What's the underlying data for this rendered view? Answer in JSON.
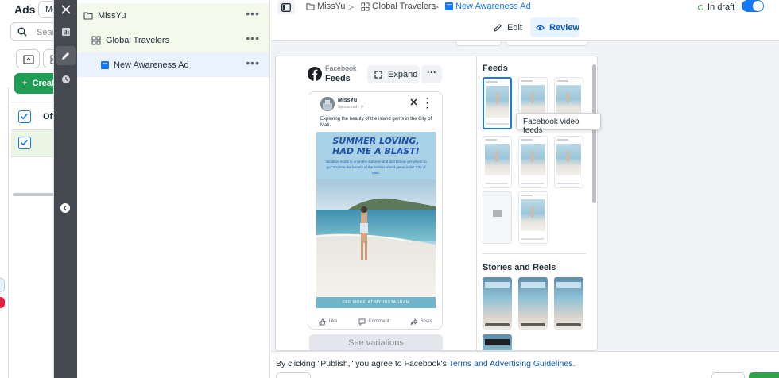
{
  "left_panel": {
    "title": "Ads",
    "tab_label": "Me",
    "search_placeholder": "Searc",
    "create_label": "Creat",
    "row_label": "Off"
  },
  "tree": {
    "items": [
      {
        "label": "MissYu",
        "icon": "folder-icon"
      },
      {
        "label": "Global Travelers",
        "icon": "grid-icon"
      },
      {
        "label": "New Awareness Ad",
        "icon": "ad-square-icon"
      }
    ],
    "more_glyph": "•••"
  },
  "topbar": {
    "breadcrumb": [
      "MissYu",
      "Global Travelers",
      "New Awareness Ad"
    ],
    "status": "In draft",
    "edit_label": "Edit",
    "review_label": "Review"
  },
  "preview": {
    "platform": "Facebook",
    "placement": "Feeds",
    "expand_label": "Expand",
    "more_glyph": "···",
    "post": {
      "page_name": "MissYu",
      "sponsored": "Sponsored · ⚲",
      "primary_text": "Exploring the beauty of the island gems in the City of Mati.",
      "headline": "SUMMER LOVING, HAD ME A BLAST!",
      "subtext": "Vacation mode is on in the summer and don't know yet where to go? Explore the beauty of the hidden island gems in the City of Mati.",
      "cta_text": "SEE MORE AT MY INSTAGRAM",
      "actions": [
        "Like",
        "Comment",
        "Share"
      ]
    },
    "see_variations_label": "See variations"
  },
  "placements": {
    "feeds_title": "Feeds",
    "stories_title": "Stories and Reels",
    "tooltip": "Facebook video feeds"
  },
  "footer": {
    "text_before": "By clicking \"Publish,\" you agree to Facebook's ",
    "link": "Terms and Advertising Guidelines",
    "text_after": "."
  },
  "colors": {
    "accent": "#1877f2",
    "create_green": "#1f9d55",
    "rail_dark": "#444950",
    "content_grey": "#f0f2f5",
    "tree_green": "#f3faec",
    "tree_selected": "#e9f2fd"
  }
}
